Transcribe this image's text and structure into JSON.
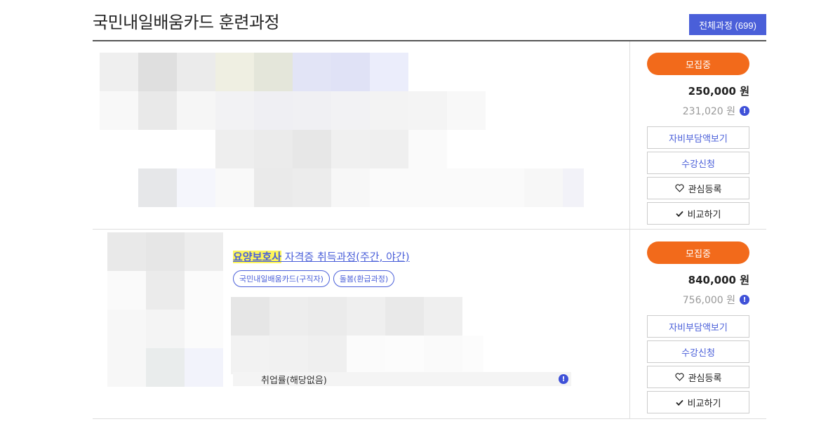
{
  "header": {
    "title": "국민내일배움카드 훈련과정",
    "total_button": "전체과정 (699)"
  },
  "courses": [
    {
      "status": "모집중",
      "price": "250,000 원",
      "sub_price": "231,020 원",
      "buttons": {
        "self_pay": "자비부담액보기",
        "apply": "수강신청",
        "wishlist": "관심등록",
        "compare": "비교하기"
      }
    },
    {
      "title_highlight": "요양보호사",
      "title_rest": " 자격증 취득과정(주간, 야간)",
      "tags": [
        "국민내일배움카드(구직자)",
        "돌봄(환급과정)"
      ],
      "employment": "취업률(해당없음)",
      "status": "모집중",
      "price": "840,000 원",
      "sub_price": "756,000 원",
      "buttons": {
        "self_pay": "자비부담액보기",
        "apply": "수강신청",
        "wishlist": "관심등록",
        "compare": "비교하기"
      }
    }
  ],
  "icons": {
    "info": "info-icon",
    "heart": "heart-icon",
    "check": "check-icon"
  },
  "colors": {
    "accent": "#4a5fd9",
    "status": "#f26a1b",
    "highlight": "#fdf55a"
  }
}
